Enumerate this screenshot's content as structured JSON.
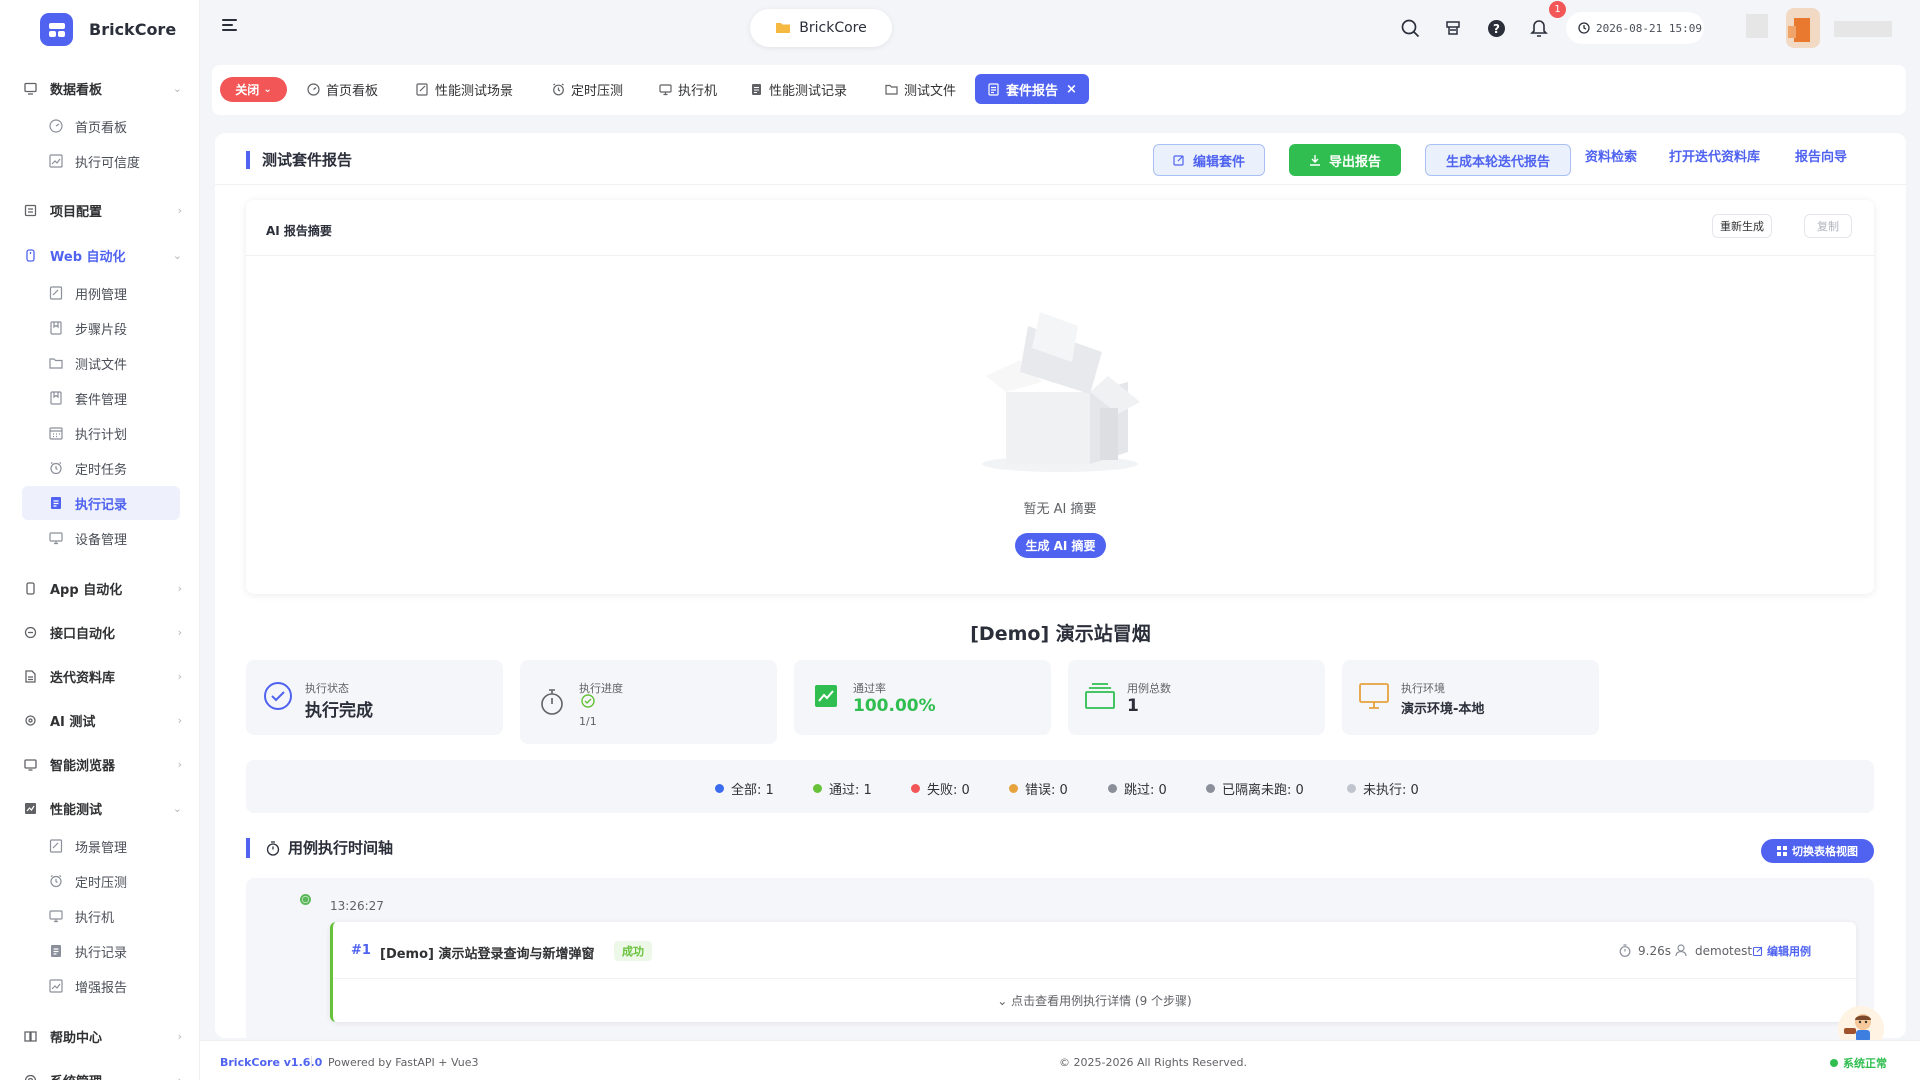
{
  "app": {
    "name": "BrickCore"
  },
  "sidebar": {
    "groups": [
      {
        "label": "数据看板",
        "icon": "dashboard-icon"
      },
      {
        "label": "项目配置",
        "icon": "project-icon"
      },
      {
        "label": "Web 自动化",
        "icon": "web-icon"
      },
      {
        "label": "App 自动化",
        "icon": "mobile-icon"
      },
      {
        "label": "接口自动化",
        "icon": "api-icon"
      },
      {
        "label": "迭代资料库",
        "icon": "library-icon"
      },
      {
        "label": "AI 测试",
        "icon": "ai-icon"
      },
      {
        "label": "智能浏览器",
        "icon": "browser-icon"
      },
      {
        "label": "性能测试",
        "icon": "performance-icon"
      },
      {
        "label": "帮助中心",
        "icon": "help-icon"
      },
      {
        "label": "系统管理",
        "icon": "settings-icon"
      }
    ],
    "dashboard_items": [
      "首页看板",
      "执行可信度"
    ],
    "web_items": [
      "用例管理",
      "步骤片段",
      "测试文件",
      "套件管理",
      "执行计划",
      "定时任务",
      "执行记录",
      "设备管理"
    ],
    "perf_items": [
      "场景管理",
      "定时压测",
      "执行机",
      "执行记录",
      "增强报告"
    ]
  },
  "header": {
    "project": "BrickCore",
    "notification_count": "1",
    "datetime": "2026-08-21 15:09"
  },
  "tabs": {
    "close_label": "关闭",
    "items": [
      "首页看板",
      "性能测试场景",
      "定时压测",
      "执行机",
      "性能测试记录",
      "测试文件",
      "套件报告"
    ],
    "close_icon": "×"
  },
  "report": {
    "title": "测试套件报告",
    "buttons": {
      "edit_suite": "编辑套件",
      "export": "导出报告",
      "iteration": "生成本轮迭代报告",
      "search": "资料检索",
      "open_library": "打开迭代资料库",
      "wizard": "报告向导"
    },
    "ai": {
      "title": "AI 报告摘要",
      "regenerate": "重新生成",
      "copy": "复制",
      "empty": "暂无 AI 摘要",
      "generate": "生成 AI 摘要"
    },
    "suite_name": "[Demo] 演示站冒烟",
    "stats": {
      "status_label": "执行状态",
      "status_value": "执行完成",
      "progress_label": "执行进度",
      "progress_value": "1/1",
      "pass_label": "通过率",
      "pass_value": "100.00%",
      "total_label": "用例总数",
      "total_value": "1",
      "env_label": "执行环境",
      "env_value": "演示环境-本地"
    },
    "legend": [
      {
        "label": "全部: 1",
        "color": "#3b6cf0"
      },
      {
        "label": "通过: 1",
        "color": "#67c23a"
      },
      {
        "label": "失败: 0",
        "color": "#f25656"
      },
      {
        "label": "错误: 0",
        "color": "#e6a23c"
      },
      {
        "label": "跳过: 0",
        "color": "#8a8f99"
      },
      {
        "label": "已隔离未跑: 0",
        "color": "#8a8f99"
      },
      {
        "label": "未执行: 0",
        "color": "#c0c4cc"
      }
    ],
    "timeline": {
      "title": "用例执行时间轴",
      "switch": "切换表格视图",
      "time": "13:26:27",
      "case_no": "#1",
      "case_name": "[Demo] 演示站登录查询与新增弹窗",
      "result": "成功",
      "duration": "9.26s",
      "user": "demotest",
      "edit": "编辑用例",
      "details": "点击查看用例执行详情 (9 个步骤)"
    }
  },
  "footer": {
    "version": "BrickCore v1.6.0",
    "powered": "Powered by FastAPI + Vue3",
    "copyright": "© 2025-2026 All Rights Reserved.",
    "status": "系统正常"
  }
}
